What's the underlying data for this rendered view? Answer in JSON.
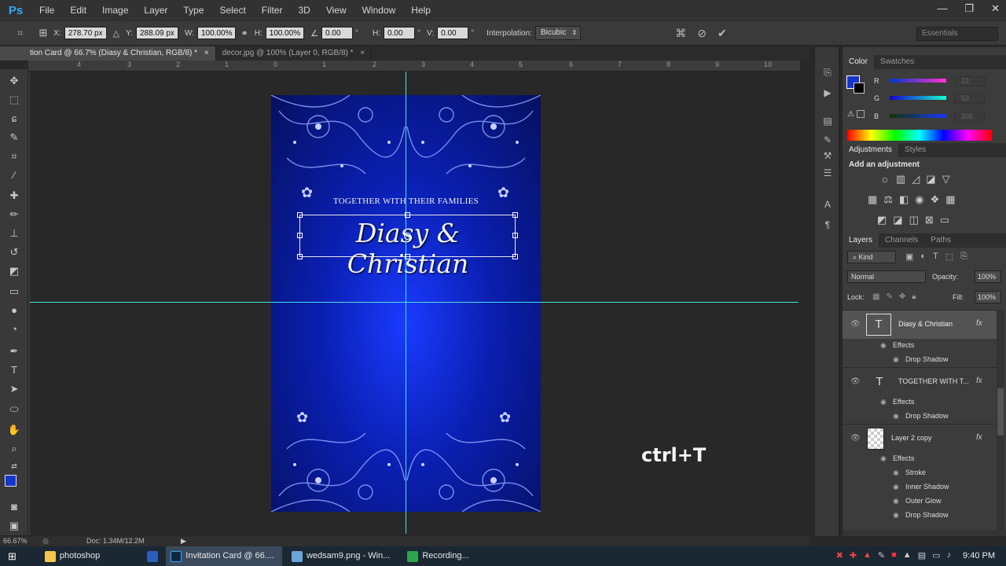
{
  "app": {
    "logo": "Ps"
  },
  "menu": [
    "File",
    "Edit",
    "Image",
    "Layer",
    "Type",
    "Select",
    "Filter",
    "3D",
    "View",
    "Window",
    "Help"
  ],
  "window_controls": {
    "minimize": "—",
    "restore": "❐",
    "close": "✕"
  },
  "options": {
    "x_label": "X:",
    "x_value": "278.70 px",
    "y_label": "Y:",
    "y_value": "288.09 px",
    "w_label": "W:",
    "w_value": "100.00%",
    "h_label": "H:",
    "h_value": "100.00%",
    "angle_value": "0.00",
    "hskew_label": "H:",
    "hskew_value": "0.00",
    "vskew_label": "V:",
    "vskew_value": "0.00",
    "degree_unit": "°",
    "interpolation_label": "Interpolation:",
    "interpolation_value": "Bicubic",
    "workspace": "Essentials"
  },
  "tabs": [
    {
      "label": "tion Card @ 66.7% (Diasy & Christian, RGB/8) *",
      "close": "×"
    },
    {
      "label": "decor.jpg @ 100% (Layer 0, RGB/8) *",
      "close": "×"
    }
  ],
  "ruler": [
    "4",
    "3",
    "2",
    "1",
    "0",
    "1",
    "2",
    "3",
    "4",
    "5",
    "6",
    "7",
    "8",
    "9",
    "10"
  ],
  "card": {
    "together_text": "TOGETHER WITH THEIR  FAMILIES",
    "names_text": "Diasy & Christian"
  },
  "overlay_hint": "ctrl+T",
  "status": {
    "zoom": "66.67%",
    "doc": "Doc: 1.34M/12.2M"
  },
  "color_panel": {
    "tabs": [
      "Color",
      "Swatches"
    ],
    "channels": [
      {
        "label": "R",
        "value": "22"
      },
      {
        "label": "G",
        "value": "53"
      },
      {
        "label": "B",
        "value": "205"
      }
    ],
    "fg_color": "#1635cd"
  },
  "adjustments_panel": {
    "tabs": [
      "Adjustments",
      "Styles"
    ],
    "title": "Add an adjustment"
  },
  "layers_panel": {
    "tabs": [
      "Layers",
      "Channels",
      "Paths"
    ],
    "filter_kind": "Kind",
    "blend_mode": "Normal",
    "opacity_label": "Opacity:",
    "opacity_value": "100%",
    "lock_label": "Lock:",
    "fill_label": "Fill:",
    "fill_value": "100%",
    "layers": [
      {
        "name": "Diasy & Christian",
        "type": "T",
        "effects_label": "Effects",
        "effects": [
          "Drop Shadow"
        ]
      },
      {
        "name": "TOGETHER WITH T...",
        "type": "T",
        "effects_label": "Effects",
        "effects": [
          "Drop Shadow"
        ]
      },
      {
        "name": "Layer 2 copy",
        "type": "raster",
        "effects_label": "Effects",
        "effects": [
          "Stroke",
          "Inner Shadow",
          "Outer Glow",
          "Drop Shadow"
        ]
      }
    ]
  },
  "taskbar": {
    "items": [
      {
        "label": "photoshop",
        "color": "#f2c94c"
      },
      {
        "label": "",
        "color": "#2b5fb8"
      },
      {
        "label": "Invitation Card @ 66....",
        "color": "#31a8ff"
      },
      {
        "label": "wedsam9.png - Win...",
        "color": "#6aa6d8"
      },
      {
        "label": "Recording...",
        "color": "#2ea44f"
      }
    ],
    "clock": "9:40 PM"
  }
}
